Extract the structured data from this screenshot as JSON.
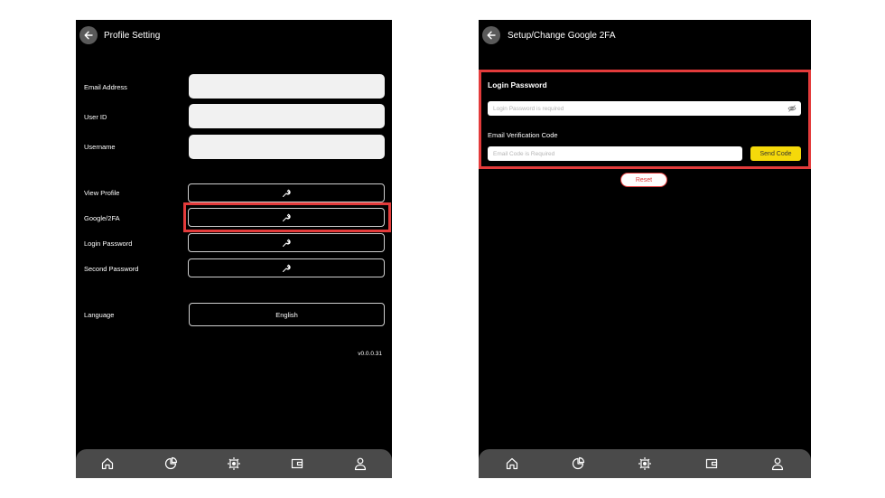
{
  "left_screen": {
    "title": "Profile Setting",
    "fields": [
      {
        "label": "Email Address",
        "value": ""
      },
      {
        "label": "User ID",
        "value": ""
      },
      {
        "label": "Username",
        "value": ""
      }
    ],
    "actions": [
      {
        "label": "View Profile",
        "icon": "wrench-icon"
      },
      {
        "label": "Google/2FA",
        "icon": "wrench-icon"
      },
      {
        "label": "Login Password",
        "icon": "wrench-icon"
      },
      {
        "label": "Second Password",
        "icon": "wrench-icon"
      }
    ],
    "language": {
      "label": "Language",
      "value": "English"
    },
    "version": "v0.0.0.31",
    "highlighted_action": "Google/2FA"
  },
  "right_screen": {
    "title": "Setup/Change Google 2FA",
    "login_password": {
      "heading": "Login Password",
      "placeholder": "Login Password is required",
      "icon": "eye-off-icon"
    },
    "email_code": {
      "heading": "Email Verification Code",
      "placeholder": "Email Code is Required",
      "button_label": "Send Code"
    },
    "reset_label": "Reset"
  },
  "bottom_nav": [
    {
      "name": "home-icon"
    },
    {
      "name": "pie-chart-icon"
    },
    {
      "name": "gear-icon"
    },
    {
      "name": "wallet-icon"
    },
    {
      "name": "user-icon"
    }
  ],
  "colors": {
    "screen_background": "#000000",
    "highlight": "#e33b3b",
    "send_code_button": "#f5d90a",
    "nav_background": "#4a4a4a",
    "input_background": "#f1f1f1"
  }
}
